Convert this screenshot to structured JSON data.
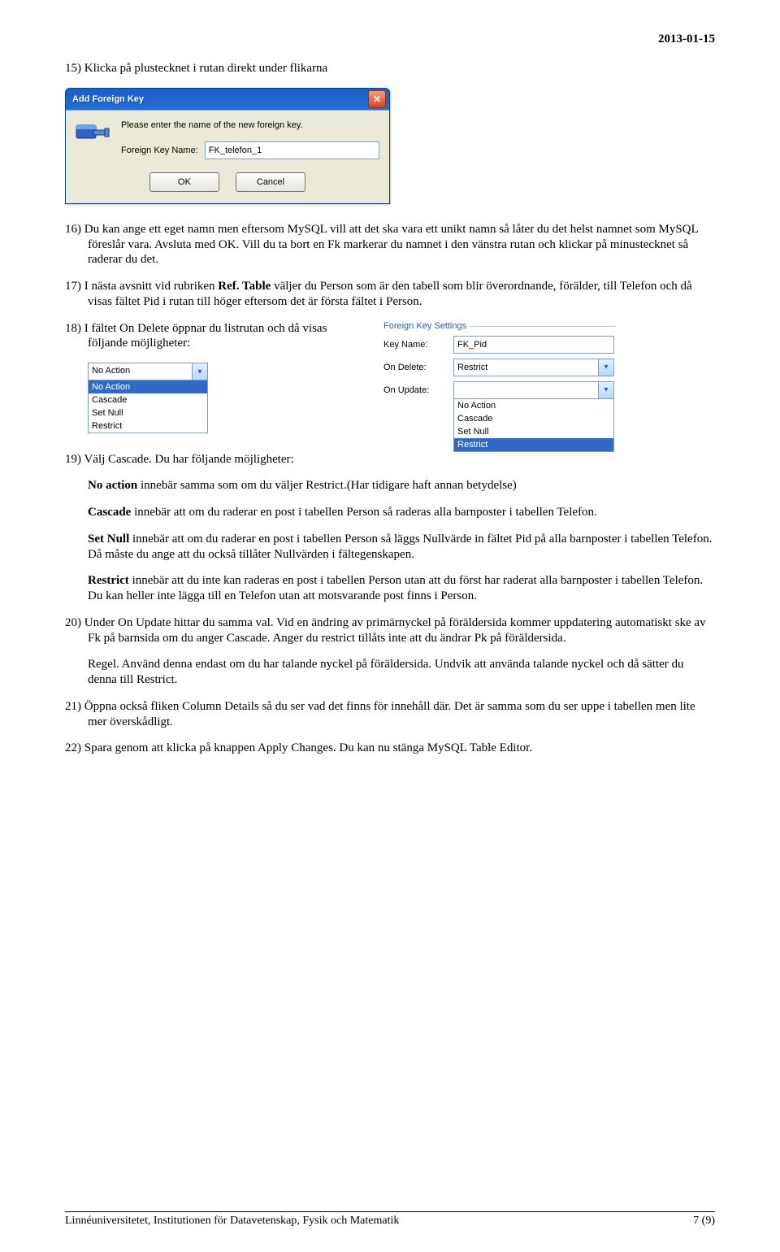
{
  "header": {
    "date": "2013-01-15"
  },
  "steps": {
    "s15": "15) Klicka på plustecknet i rutan direkt under flikarna",
    "s16": "16) Du kan ange ett eget namn men eftersom MySQL vill att det ska vara ett unikt namn så låter du det helst namnet som MySQL föreslår vara. Avsluta med OK. Vill du ta bort en Fk markerar du namnet i den vänstra rutan och klickar på minustecknet så raderar du det.",
    "s17_pre": "17) I nästa avsnitt vid rubriken ",
    "s17_bold": "Ref. Table",
    "s17_post": " väljer du Person som är den tabell som blir överordnande, förälder, till Telefon och då visas fältet Pid i rutan till höger eftersom det är första fältet i Person.",
    "s18": "18) I fältet On Delete öppnar du listrutan och då visas följande möjligheter:",
    "s19_lead": "19) Välj Cascade. Du har följande möjligheter:",
    "s19_noaction_b": "No action",
    "s19_noaction": " innebär samma som om du väljer Restrict.(Har tidigare haft annan betydelse)",
    "s19_cascade_b": "Cascade",
    "s19_cascade": " innebär att om du raderar en post i tabellen Person så raderas alla barnposter i tabellen Telefon.",
    "s19_setnull_b": "Set Null",
    "s19_setnull": " innebär att om du raderar en post i tabellen Person så läggs Nullvärde in fältet Pid på alla barnposter i tabellen Telefon. Då måste du ange att du också tillåter Nullvärden i fältegenskapen.",
    "s19_restrict_b": "Restrict",
    "s19_restrict": " innebär att du inte kan raderas en post i tabellen Person utan att du först har raderat alla barnposter i tabellen Telefon. Du kan heller inte lägga till en Telefon utan att motsvarande post finns i Person.",
    "s20a": "20) Under On Update hittar du samma val. Vid en ändring av primärnyckel på föräldersida kommer uppdatering automatiskt ske av Fk på barnsida om du anger Cascade. Anger du restrict tillåts inte att du ändrar Pk på föräldersida.",
    "s20b": "Regel. Använd denna endast om du har talande nyckel på föräldersida. Undvik att använda talande nyckel och då sätter du denna till Restrict.",
    "s21": "21) Öppna också fliken Column Details så du ser vad det finns för innehåll där. Det är samma som du ser uppe i tabellen men lite mer överskådligt.",
    "s22": "22) Spara genom att klicka på knappen Apply Changes. Du kan nu stänga MySQL Table Editor."
  },
  "dialog_afk": {
    "title": "Add Foreign Key",
    "prompt": "Please enter the name of the new foreign key.",
    "field_label": "Foreign Key Name:",
    "field_value": "FK_telefon_1",
    "ok": "OK",
    "cancel": "Cancel"
  },
  "combo_ondelete": {
    "selected": "No Action",
    "options": [
      "No Action",
      "Cascade",
      "Set Null",
      "Restrict"
    ],
    "highlight_index": 0
  },
  "fk_settings": {
    "group_title": "Foreign Key Settings",
    "key_name_label": "Key Name:",
    "key_name_value": "FK_Pid",
    "on_delete_label": "On Delete:",
    "on_delete_value": "Restrict",
    "on_update_label": "On Update:",
    "on_update_list": [
      "No Action",
      "Cascade",
      "Set Null",
      "Restrict"
    ],
    "on_update_highlight_index": 3
  },
  "footer": {
    "left": "Linnéuniversitetet, Institutionen för Datavetenskap, Fysik och Matematik",
    "right": "7 (9)"
  }
}
